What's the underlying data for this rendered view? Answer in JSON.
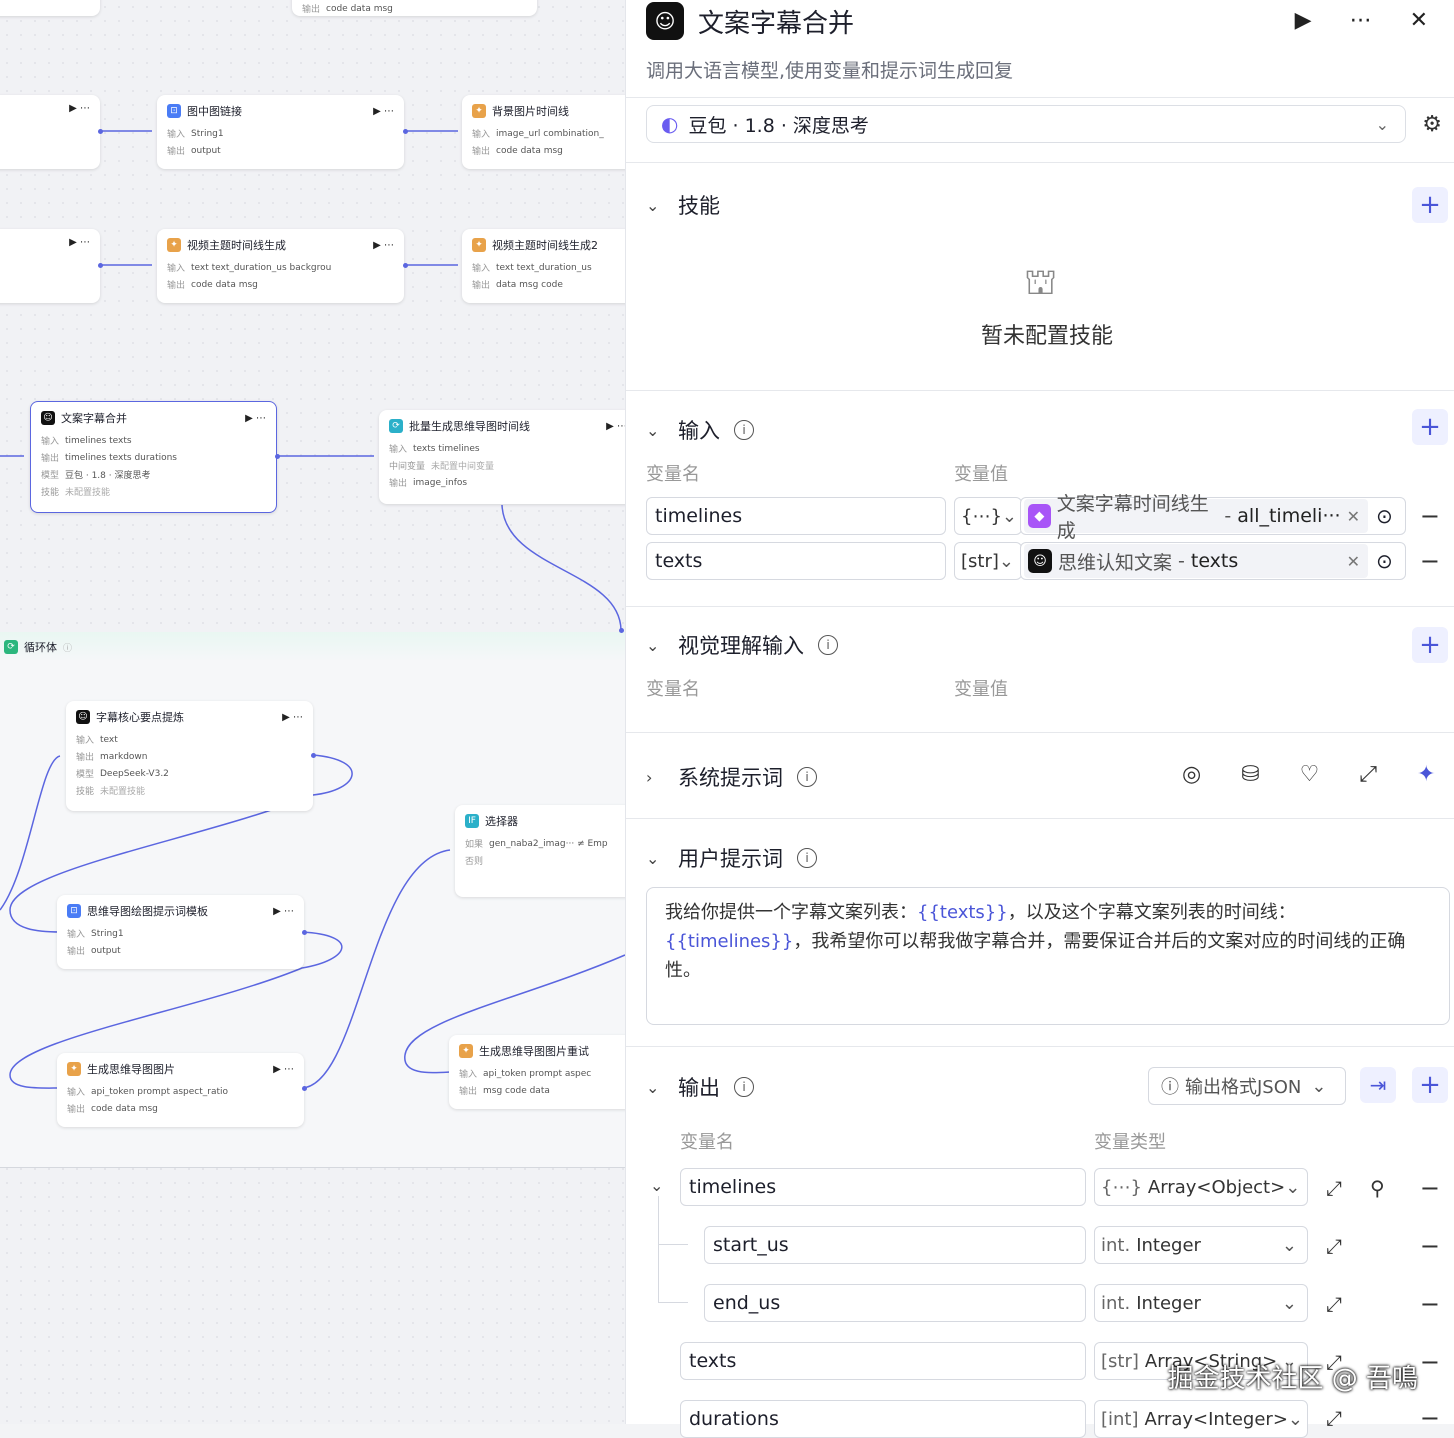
{
  "canvas": {
    "top_nodes": [
      {
        "title": "图中图链接",
        "in_label": "输入",
        "in": "String1",
        "out_label": "输出",
        "out": "output"
      },
      {
        "title": "背景图片时间线",
        "in_label": "输入",
        "in": "image_url  combination_",
        "out_label": "输出",
        "out": "code  data  msg"
      },
      {
        "title": "视频主题时间线生成",
        "in_label": "输入",
        "in": "text  text_duration_us  backgrou",
        "out_label": "输出",
        "out": "code  data  msg"
      },
      {
        "title": "视频主题时间线生成2",
        "in_label": "输入",
        "in": "text  text_duration_us",
        "out_label": "输出",
        "out": "data  msg  code"
      }
    ],
    "top_stub": "code  data  msg",
    "main_node": {
      "title": "文案字幕合并",
      "in_label": "输入",
      "in": "timelines  texts",
      "out_label": "输出",
      "out": "timelines  texts  durations",
      "model_label": "模型",
      "model": "豆包 · 1.8 · 深度思考",
      "skill_label": "技能",
      "skill": "未配置技能"
    },
    "batch_node": {
      "title": "批量生成思维导图时间线",
      "in_label": "输入",
      "in": "texts  timelines",
      "mid_label": "中间变量",
      "mid": "未配置中间变量",
      "out_label": "输出",
      "out": "image_infos"
    },
    "loop_label": "循环体",
    "loop_nodes": [
      {
        "title": "字幕核心要点提炼",
        "in_label": "输入",
        "in": "text",
        "out_label": "输出",
        "out": "markdown",
        "model_label": "模型",
        "model": "DeepSeek-V3.2",
        "skill_label": "技能",
        "skill": "未配置技能"
      },
      {
        "title": "思维导图绘图提示词模板",
        "in_label": "输入",
        "in": "String1",
        "out_label": "输出",
        "out": "output"
      },
      {
        "title": "生成思维导图图片",
        "in_label": "输入",
        "in": "api_token  prompt  aspect_ratio",
        "out_label": "输出",
        "out": "code  data  msg"
      },
      {
        "title": "选择器",
        "if_label": "如果",
        "if": "gen_naba2_imag···  ≠  Emp",
        "else_label": "否则"
      },
      {
        "title": "生成思维导图图片重试",
        "in_label": "输入",
        "in": "api_token  prompt  aspec",
        "out_label": "输出",
        "out": "msg  code  data"
      }
    ]
  },
  "panel": {
    "title": "文案字幕合并",
    "description": "调用大语言模型,使用变量和提示词生成回复",
    "model": "豆包 · 1.8 · 深度思考",
    "skills": {
      "title": "技能",
      "empty": "暂未配置技能"
    },
    "inputs": {
      "title": "输入",
      "col_name": "变量名",
      "col_value": "变量值",
      "rows": [
        {
          "name": "timelines",
          "type": "{⋯}",
          "source_node": "文案字幕时间线生成",
          "source_var": "all_timeli···"
        },
        {
          "name": "texts",
          "type": "[str]",
          "source_node": "思维认知文案",
          "source_var": "texts"
        }
      ]
    },
    "vision": {
      "title": "视觉理解输入",
      "col_name": "变量名",
      "col_value": "变量值"
    },
    "system_prompt": {
      "title": "系统提示词"
    },
    "user_prompt": {
      "title": "用户提示词",
      "p1": "我给你提供一个字幕文案列表：",
      "v1": "{{texts}}",
      "p2": "，以及这个字幕文案列表的时间线：",
      "v2": "{{timelines}}",
      "p3": "，我希望你可以帮我做字幕合并，需要保证合并后的文案对应的时间线的正确性。"
    },
    "outputs": {
      "title": "输出",
      "format": "输出格式JSON",
      "col_name": "变量名",
      "col_type": "变量类型",
      "rows": [
        {
          "name": "timelines",
          "type_icon": "{⋯}",
          "type": "Array<Object>"
        },
        {
          "name": "start_us",
          "type_icon": "int.",
          "type": "Integer"
        },
        {
          "name": "end_us",
          "type_icon": "int.",
          "type": "Integer"
        },
        {
          "name": "texts",
          "type_icon": "[str]",
          "type": "Array<String>"
        },
        {
          "name": "durations",
          "type_icon": "[int]",
          "type": "Array<Integer>"
        }
      ]
    }
  },
  "watermark": "掘金技术社区 @ 吾鳴",
  "colors": {
    "accent": "#4a55d8",
    "selected_border": "#5b66e0"
  }
}
